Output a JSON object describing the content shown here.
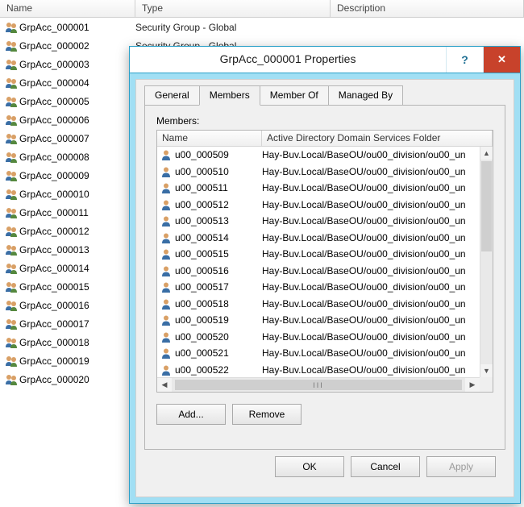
{
  "console": {
    "columns": {
      "name": "Name",
      "type": "Type",
      "description": "Description"
    },
    "type_label": "Security Group - Global",
    "visible_type_rows": 2,
    "rows": [
      {
        "name": "GrpAcc_000001"
      },
      {
        "name": "GrpAcc_000002"
      },
      {
        "name": "GrpAcc_000003"
      },
      {
        "name": "GrpAcc_000004"
      },
      {
        "name": "GrpAcc_000005"
      },
      {
        "name": "GrpAcc_000006"
      },
      {
        "name": "GrpAcc_000007"
      },
      {
        "name": "GrpAcc_000008"
      },
      {
        "name": "GrpAcc_000009"
      },
      {
        "name": "GrpAcc_000010"
      },
      {
        "name": "GrpAcc_000011"
      },
      {
        "name": "GrpAcc_000012"
      },
      {
        "name": "GrpAcc_000013"
      },
      {
        "name": "GrpAcc_000014"
      },
      {
        "name": "GrpAcc_000015"
      },
      {
        "name": "GrpAcc_000016"
      },
      {
        "name": "GrpAcc_000017"
      },
      {
        "name": "GrpAcc_000018"
      },
      {
        "name": "GrpAcc_000019"
      },
      {
        "name": "GrpAcc_000020"
      }
    ]
  },
  "dialog": {
    "title": "GrpAcc_000001 Properties",
    "help_glyph": "?",
    "close_glyph": "✕",
    "tabs": {
      "general": "General",
      "members": "Members",
      "member_of": "Member Of",
      "managed_by": "Managed By",
      "active": "members"
    },
    "members_label": "Members:",
    "list_columns": {
      "name": "Name",
      "folder": "Active Directory Domain Services Folder"
    },
    "folder_value": "Hay-Buv.Local/BaseOU/ou00_division/ou00_un",
    "members": [
      {
        "name": "u00_000509"
      },
      {
        "name": "u00_000510"
      },
      {
        "name": "u00_000511"
      },
      {
        "name": "u00_000512"
      },
      {
        "name": "u00_000513"
      },
      {
        "name": "u00_000514"
      },
      {
        "name": "u00_000515"
      },
      {
        "name": "u00_000516"
      },
      {
        "name": "u00_000517"
      },
      {
        "name": "u00_000518"
      },
      {
        "name": "u00_000519"
      },
      {
        "name": "u00_000520"
      },
      {
        "name": "u00_000521"
      },
      {
        "name": "u00_000522"
      }
    ],
    "scroll": {
      "up": "▲",
      "down": "▼",
      "left": "◀",
      "right": "▶",
      "grip": "III"
    },
    "buttons": {
      "add": "Add...",
      "remove": "Remove",
      "ok": "OK",
      "cancel": "Cancel",
      "apply": "Apply"
    }
  }
}
